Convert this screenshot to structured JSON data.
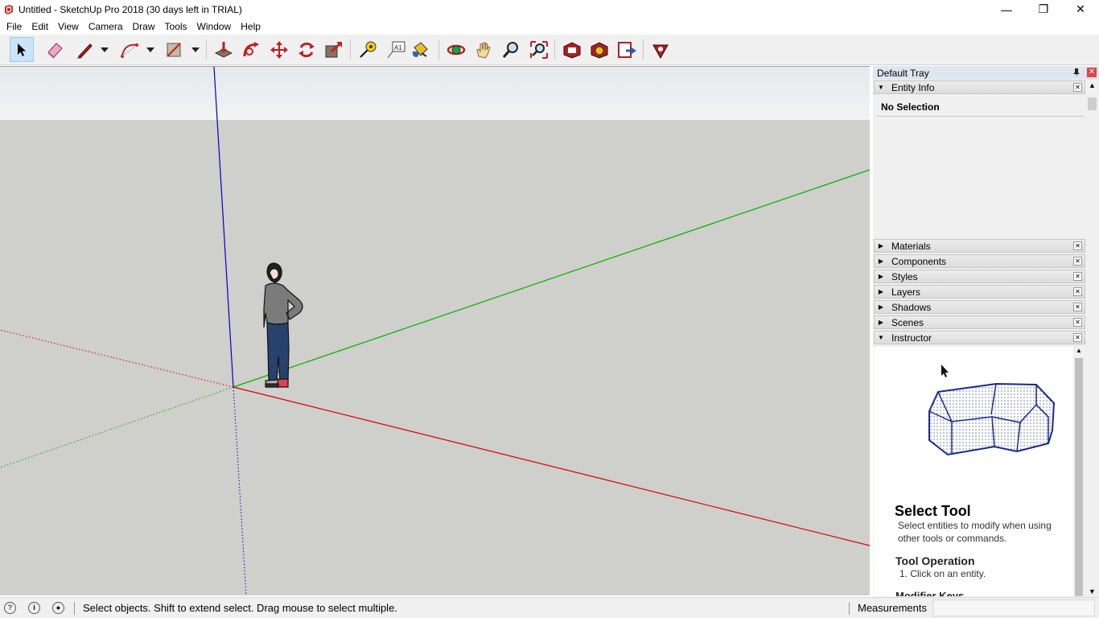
{
  "window": {
    "title": "Untitled - SketchUp Pro 2018 (30 days left in TRIAL)",
    "buttons": {
      "minimize": "—",
      "restore": "❐",
      "close": "✕"
    }
  },
  "menu": [
    "File",
    "Edit",
    "View",
    "Camera",
    "Draw",
    "Tools",
    "Window",
    "Help"
  ],
  "toolbar": {
    "tools": [
      "select-icon",
      "eraser-icon",
      "line-icon",
      "arc-icon",
      "rectangle-icon",
      "push-pull-icon",
      "follow-me-icon",
      "move-icon",
      "rotate-icon",
      "scale-icon",
      "tape-measure-icon",
      "text-icon",
      "paint-bucket-icon",
      "orbit-icon",
      "pan-icon",
      "zoom-icon",
      "zoom-extents-icon",
      "3d-warehouse-icon",
      "extension-warehouse-icon",
      "send-to-layout-icon",
      "extension-manager-icon"
    ]
  },
  "tray": {
    "title": "Default Tray",
    "entity_info": {
      "label": "Entity Info",
      "selection": "No Selection"
    },
    "panels": [
      "Materials",
      "Components",
      "Styles",
      "Layers",
      "Shadows",
      "Scenes"
    ],
    "instructor": {
      "label": "Instructor",
      "heading": "Select Tool",
      "description": "Select entities to modify when using other tools or commands.",
      "operation_heading": "Tool Operation",
      "operation_step": "1. Click on an entity.",
      "modifier_heading": "Modifier Keys"
    }
  },
  "status": {
    "message": "Select objects. Shift to extend select. Drag mouse to select multiple.",
    "measurements_label": "Measurements",
    "measurements_value": ""
  },
  "colors": {
    "axis_red": "#d40000",
    "axis_green": "#00b000",
    "axis_blue": "#0000c8",
    "viewport_ground": "#cfcfcb",
    "selected_tool": "#cce4f7"
  }
}
